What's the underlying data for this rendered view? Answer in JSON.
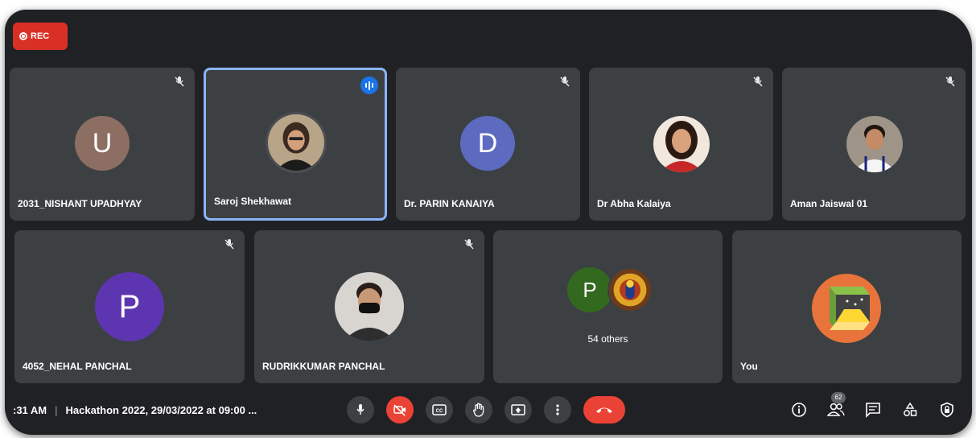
{
  "recording": {
    "label": "REC",
    "color": "#d93025"
  },
  "participants": [
    {
      "name": "2031_NISHANT UPADHYAY",
      "initial": "U",
      "avatar_color": "#8d6e63",
      "muted": true
    },
    {
      "name": "Saroj Shekhawat",
      "avatar_type": "photo",
      "speaking": true
    },
    {
      "name": "Dr. PARIN KANAIYA",
      "initial": "D",
      "avatar_color": "#5c6bc0",
      "muted": true
    },
    {
      "name": "Dr Abha Kalaiya",
      "avatar_type": "photo",
      "muted": true
    },
    {
      "name": "Aman Jaiswal 01",
      "avatar_type": "photo",
      "muted": true
    },
    {
      "name": "4052_NEHAL PANCHAL",
      "initial": "P",
      "avatar_color": "#5e35b1",
      "muted": true
    },
    {
      "name": "RUDRIKKUMAR PANCHAL",
      "avatar_type": "photo",
      "muted": true
    },
    {
      "others_label": "54 others",
      "initial": "P",
      "avatar_color": "#33691e"
    },
    {
      "name": "You",
      "avatar_type": "logo"
    }
  ],
  "bottom_bar": {
    "time": ":31 AM",
    "meeting_title": "Hackathon 2022, 29/03/2022 at 09:00 ...",
    "participant_count": "62",
    "controls": [
      "mic-icon",
      "camera-off-icon",
      "captions-icon",
      "raise-hand-icon",
      "present-icon",
      "more-options-icon",
      "hangup-icon"
    ],
    "right_icons": [
      "info-icon",
      "people-icon",
      "chat-icon",
      "activities-icon",
      "host-controls-icon"
    ]
  },
  "colors": {
    "background": "#202124",
    "tile": "#3c4043",
    "accent": "#8ab4f8",
    "danger": "#ea4335"
  }
}
